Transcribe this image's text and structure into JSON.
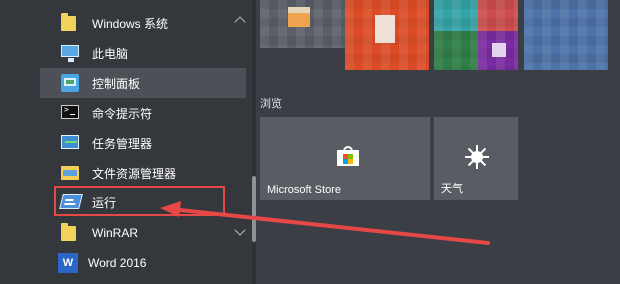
{
  "left_menu": {
    "items": [
      {
        "label": "Windows 系统",
        "icon": "folder-icon",
        "indicator": "chevron-up-icon"
      },
      {
        "label": "此电脑",
        "icon": "computer-icon"
      },
      {
        "label": "控制面板",
        "icon": "control-panel-icon"
      },
      {
        "label": "命令提示符",
        "icon": "command-prompt-icon"
      },
      {
        "label": "任务管理器",
        "icon": "task-manager-icon"
      },
      {
        "label": "文件资源管理器",
        "icon": "file-explorer-icon"
      },
      {
        "label": "运行",
        "icon": "run-icon"
      },
      {
        "label": "WinRAR",
        "icon": "folder-icon",
        "indicator": "chevron-down-icon"
      },
      {
        "label": "Word 2016",
        "icon": "word-icon"
      }
    ]
  },
  "right_pane": {
    "section_title": "浏览",
    "tiles": [
      {
        "label": "Microsoft Store",
        "icon": "store-icon"
      },
      {
        "label": "天气",
        "icon": "sun-icon"
      }
    ]
  },
  "colors": {
    "highlight": "#e64747",
    "selected_row": "#4d5056",
    "word_blue": "#2b66c7"
  }
}
